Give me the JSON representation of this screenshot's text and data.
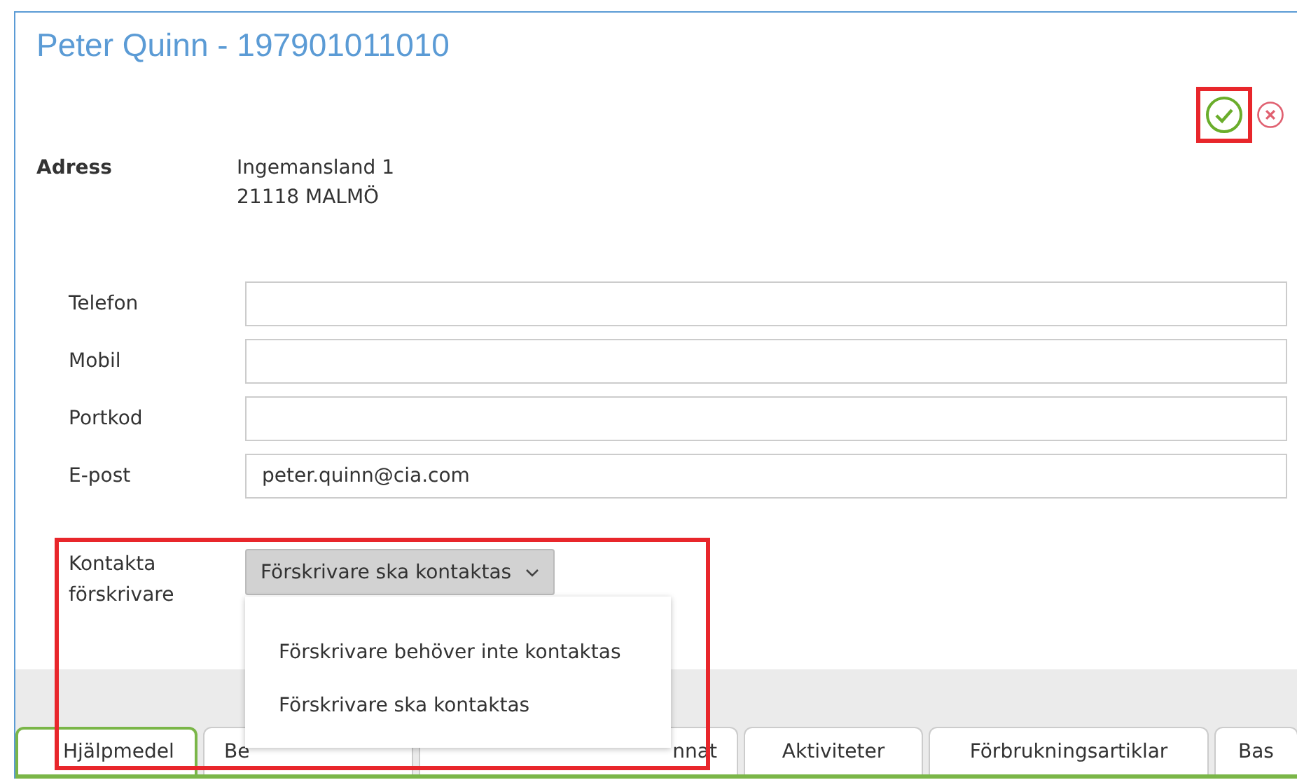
{
  "title": "Peter Quinn - 197901011010",
  "actions": [
    {
      "kind": "save",
      "highlighted": true
    },
    {
      "kind": "cancel",
      "highlighted": false
    }
  ],
  "address": {
    "label": "Adress",
    "lines": [
      "Ingemansland 1",
      "21118 MALMÖ"
    ]
  },
  "fields": [
    {
      "label": "Telefon"
    },
    {
      "label": "Mobil"
    },
    {
      "label": "Portkod"
    },
    {
      "label": "E-post",
      "value": "peter.quinn@cia.com"
    }
  ],
  "contact": {
    "label": "Kontakta förskrivare",
    "value": "Förskrivare ska kontaktas",
    "expanded": true,
    "highlighted": true,
    "options": [
      "Förskrivare behöver inte kontaktas",
      "Förskrivare ska kontaktas"
    ]
  },
  "tabs": [
    {
      "label": "Hjälpmedel",
      "selected": true
    },
    {
      "label": "Be",
      "selected": false
    },
    {
      "label": "nnat",
      "selected": false
    },
    {
      "label": "Aktiviteter",
      "selected": false
    },
    {
      "label": "Förbrukningsartiklar",
      "selected": false
    },
    {
      "label": "Bas",
      "selected": false
    }
  ]
}
